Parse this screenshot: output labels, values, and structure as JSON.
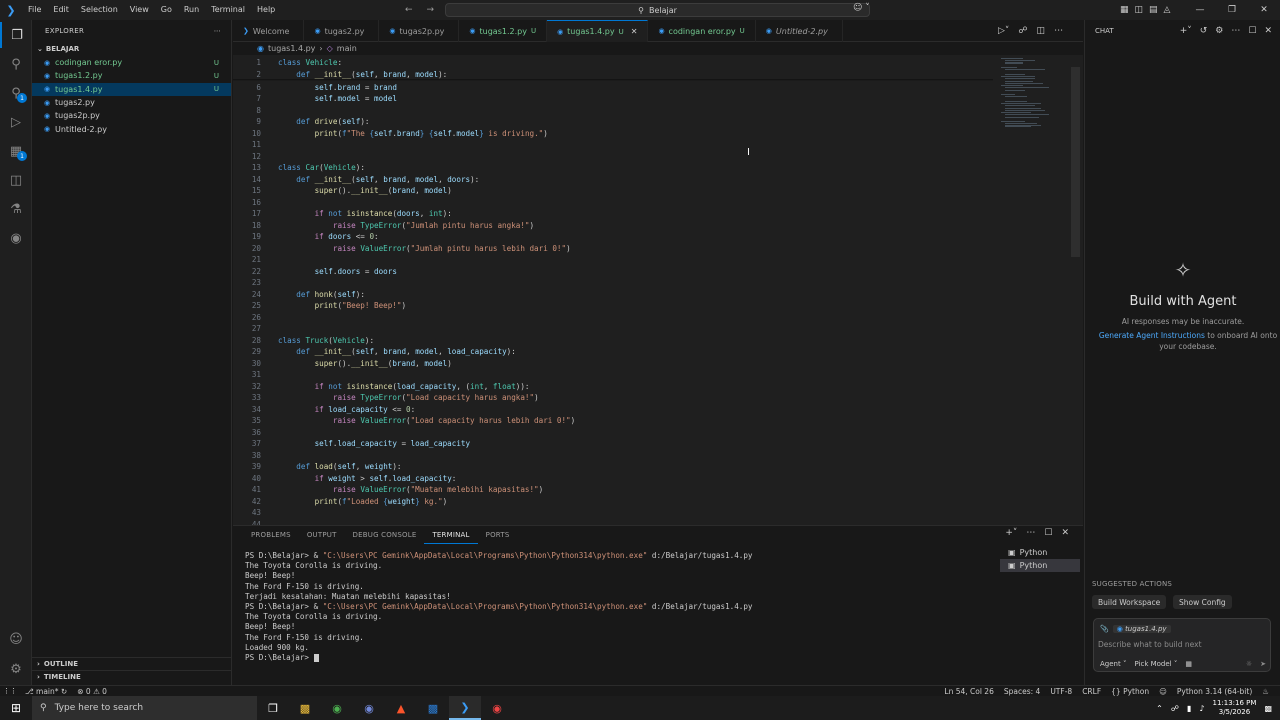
{
  "titlebar": {
    "menu": [
      "File",
      "Edit",
      "Selection",
      "View",
      "Go",
      "Run",
      "Terminal",
      "Help"
    ],
    "search": "Belajar"
  },
  "explorer": {
    "title": "EXPLORER",
    "folder": "BELAJAR",
    "files": [
      {
        "name": "codingan eror.py",
        "status": "U",
        "modified": true,
        "selected": false
      },
      {
        "name": "tugas1.2.py",
        "status": "U",
        "modified": true,
        "selected": false
      },
      {
        "name": "tugas1.4.py",
        "status": "U",
        "modified": true,
        "selected": true
      },
      {
        "name": "tugas2.py",
        "status": "",
        "modified": false,
        "selected": false
      },
      {
        "name": "tugas2p.py",
        "status": "",
        "modified": false,
        "selected": false
      },
      {
        "name": "Untitled-2.py",
        "status": "",
        "modified": false,
        "selected": false
      }
    ],
    "outline": "OUTLINE",
    "timeline": "TIMELINE"
  },
  "tabs": [
    {
      "label": "Welcome",
      "icon": "vscode-icon",
      "status": "",
      "modified": false,
      "italic": false,
      "active": false
    },
    {
      "label": "tugas2.py",
      "icon": "python-icon",
      "status": "",
      "modified": false,
      "italic": false,
      "active": false
    },
    {
      "label": "tugas2p.py",
      "icon": "python-icon",
      "status": "",
      "modified": false,
      "italic": false,
      "active": false
    },
    {
      "label": "tugas1.2.py",
      "icon": "python-icon",
      "status": "U",
      "modified": true,
      "italic": false,
      "active": false
    },
    {
      "label": "tugas1.4.py",
      "icon": "python-icon",
      "status": "U",
      "modified": true,
      "italic": false,
      "active": true
    },
    {
      "label": "codingan eror.py",
      "icon": "python-icon",
      "status": "U",
      "modified": true,
      "italic": false,
      "active": false
    },
    {
      "label": "Untitled-2.py",
      "icon": "python-icon",
      "status": "",
      "modified": false,
      "italic": true,
      "active": false
    }
  ],
  "breadcrumb": {
    "file": "tugas1.4.py",
    "symbol": "main"
  },
  "code": [
    {
      "n": "1",
      "t": [
        [
          "kw",
          "class "
        ],
        [
          "cls",
          "Vehicle"
        ],
        [
          "",
          ":"
        ]
      ]
    },
    {
      "n": "2",
      "t": [
        [
          "",
          "    "
        ],
        [
          "kw",
          "def "
        ],
        [
          "fn",
          "__init__"
        ],
        [
          "",
          "("
        ],
        [
          "var",
          "self"
        ],
        [
          "",
          ", "
        ],
        [
          "var",
          "brand"
        ],
        [
          "",
          ", "
        ],
        [
          "var",
          "model"
        ],
        [
          "",
          "):"
        ]
      ]
    },
    {
      "n": "6",
      "t": [
        [
          "",
          "        "
        ],
        [
          "var",
          "self"
        ],
        [
          "",
          "."
        ],
        [
          "var",
          "brand"
        ],
        [
          "",
          " = "
        ],
        [
          "var",
          "brand"
        ]
      ]
    },
    {
      "n": "7",
      "t": [
        [
          "",
          "        "
        ],
        [
          "var",
          "self"
        ],
        [
          "",
          "."
        ],
        [
          "var",
          "model"
        ],
        [
          "",
          " = "
        ],
        [
          "var",
          "model"
        ]
      ]
    },
    {
      "n": "8",
      "t": []
    },
    {
      "n": "9",
      "t": [
        [
          "",
          "    "
        ],
        [
          "kw",
          "def "
        ],
        [
          "fn",
          "drive"
        ],
        [
          "",
          "("
        ],
        [
          "var",
          "self"
        ],
        [
          "",
          "):"
        ]
      ]
    },
    {
      "n": "10",
      "t": [
        [
          "",
          "        "
        ],
        [
          "fn",
          "print"
        ],
        [
          "",
          "("
        ],
        [
          "fstr",
          "f"
        ],
        [
          "str",
          "\"The "
        ],
        [
          "fstr",
          "{"
        ],
        [
          "var",
          "self"
        ],
        [
          "",
          "."
        ],
        [
          "var",
          "brand"
        ],
        [
          "fstr",
          "}"
        ],
        [
          "str",
          " "
        ],
        [
          "fstr",
          "{"
        ],
        [
          "var",
          "self"
        ],
        [
          "",
          "."
        ],
        [
          "var",
          "model"
        ],
        [
          "fstr",
          "}"
        ],
        [
          "str",
          " is driving.\""
        ],
        [
          "",
          ")"
        ]
      ]
    },
    {
      "n": "11",
      "t": []
    },
    {
      "n": "12",
      "t": []
    },
    {
      "n": "13",
      "t": [
        [
          "kw",
          "class "
        ],
        [
          "cls",
          "Car"
        ],
        [
          "",
          "("
        ],
        [
          "cls",
          "Vehicle"
        ],
        [
          "",
          "):"
        ]
      ]
    },
    {
      "n": "14",
      "t": [
        [
          "",
          "    "
        ],
        [
          "kw",
          "def "
        ],
        [
          "fn",
          "__init__"
        ],
        [
          "",
          "("
        ],
        [
          "var",
          "self"
        ],
        [
          "",
          ", "
        ],
        [
          "var",
          "brand"
        ],
        [
          "",
          ", "
        ],
        [
          "var",
          "model"
        ],
        [
          "",
          ", "
        ],
        [
          "var",
          "doors"
        ],
        [
          "",
          "):"
        ]
      ]
    },
    {
      "n": "15",
      "t": [
        [
          "",
          "        "
        ],
        [
          "fn",
          "super"
        ],
        [
          "",
          "()."
        ],
        [
          "fn",
          "__init__"
        ],
        [
          "",
          "("
        ],
        [
          "var",
          "brand"
        ],
        [
          "",
          ", "
        ],
        [
          "var",
          "model"
        ],
        [
          "",
          ")"
        ]
      ]
    },
    {
      "n": "16",
      "t": []
    },
    {
      "n": "17",
      "t": [
        [
          "",
          "        "
        ],
        [
          "kw2",
          "if "
        ],
        [
          "kw",
          "not "
        ],
        [
          "fn",
          "isinstance"
        ],
        [
          "",
          "("
        ],
        [
          "var",
          "doors"
        ],
        [
          "",
          ", "
        ],
        [
          "cls",
          "int"
        ],
        [
          "",
          "):"
        ]
      ]
    },
    {
      "n": "18",
      "t": [
        [
          "",
          "            "
        ],
        [
          "kw2",
          "raise "
        ],
        [
          "cls",
          "TypeError"
        ],
        [
          "",
          "("
        ],
        [
          "str",
          "\"Jumlah pintu harus angka!\""
        ],
        [
          "",
          ")"
        ]
      ]
    },
    {
      "n": "19",
      "t": [
        [
          "",
          "        "
        ],
        [
          "kw2",
          "if "
        ],
        [
          "var",
          "doors"
        ],
        [
          "",
          " <= "
        ],
        [
          "num",
          "0"
        ],
        [
          "",
          ":"
        ]
      ]
    },
    {
      "n": "20",
      "t": [
        [
          "",
          "            "
        ],
        [
          "kw2",
          "raise "
        ],
        [
          "cls",
          "ValueError"
        ],
        [
          "",
          "("
        ],
        [
          "str",
          "\"Jumlah pintu harus lebih dari 0!\""
        ],
        [
          "",
          ")"
        ]
      ]
    },
    {
      "n": "21",
      "t": []
    },
    {
      "n": "22",
      "t": [
        [
          "",
          "        "
        ],
        [
          "var",
          "self"
        ],
        [
          "",
          "."
        ],
        [
          "var",
          "doors"
        ],
        [
          "",
          " = "
        ],
        [
          "var",
          "doors"
        ]
      ]
    },
    {
      "n": "23",
      "t": []
    },
    {
      "n": "24",
      "t": [
        [
          "",
          "    "
        ],
        [
          "kw",
          "def "
        ],
        [
          "fn",
          "honk"
        ],
        [
          "",
          "("
        ],
        [
          "var",
          "self"
        ],
        [
          "",
          "):"
        ]
      ]
    },
    {
      "n": "25",
      "t": [
        [
          "",
          "        "
        ],
        [
          "fn",
          "print"
        ],
        [
          "",
          "("
        ],
        [
          "str",
          "\"Beep! Beep!\""
        ],
        [
          "",
          ")"
        ]
      ]
    },
    {
      "n": "26",
      "t": []
    },
    {
      "n": "27",
      "t": []
    },
    {
      "n": "28",
      "t": [
        [
          "kw",
          "class "
        ],
        [
          "cls",
          "Truck"
        ],
        [
          "",
          "("
        ],
        [
          "cls",
          "Vehicle"
        ],
        [
          "",
          "):"
        ]
      ]
    },
    {
      "n": "29",
      "t": [
        [
          "",
          "    "
        ],
        [
          "kw",
          "def "
        ],
        [
          "fn",
          "__init__"
        ],
        [
          "",
          "("
        ],
        [
          "var",
          "self"
        ],
        [
          "",
          ", "
        ],
        [
          "var",
          "brand"
        ],
        [
          "",
          ", "
        ],
        [
          "var",
          "model"
        ],
        [
          "",
          ", "
        ],
        [
          "var",
          "load_capacity"
        ],
        [
          "",
          "):"
        ]
      ]
    },
    {
      "n": "30",
      "t": [
        [
          "",
          "        "
        ],
        [
          "fn",
          "super"
        ],
        [
          "",
          "()."
        ],
        [
          "fn",
          "__init__"
        ],
        [
          "",
          "("
        ],
        [
          "var",
          "brand"
        ],
        [
          "",
          ", "
        ],
        [
          "var",
          "model"
        ],
        [
          "",
          ")"
        ]
      ]
    },
    {
      "n": "31",
      "t": []
    },
    {
      "n": "32",
      "t": [
        [
          "",
          "        "
        ],
        [
          "kw2",
          "if "
        ],
        [
          "kw",
          "not "
        ],
        [
          "fn",
          "isinstance"
        ],
        [
          "",
          "("
        ],
        [
          "var",
          "load_capacity"
        ],
        [
          "",
          ", ("
        ],
        [
          "cls",
          "int"
        ],
        [
          "",
          ", "
        ],
        [
          "cls",
          "float"
        ],
        [
          "",
          ")):"
        ]
      ]
    },
    {
      "n": "33",
      "t": [
        [
          "",
          "            "
        ],
        [
          "kw2",
          "raise "
        ],
        [
          "cls",
          "TypeError"
        ],
        [
          "",
          "("
        ],
        [
          "str",
          "\"Load capacity harus angka!\""
        ],
        [
          "",
          ")"
        ]
      ]
    },
    {
      "n": "34",
      "t": [
        [
          "",
          "        "
        ],
        [
          "kw2",
          "if "
        ],
        [
          "var",
          "load_capacity"
        ],
        [
          "",
          " <= "
        ],
        [
          "num",
          "0"
        ],
        [
          "",
          ":"
        ]
      ]
    },
    {
      "n": "35",
      "t": [
        [
          "",
          "            "
        ],
        [
          "kw2",
          "raise "
        ],
        [
          "cls",
          "ValueError"
        ],
        [
          "",
          "("
        ],
        [
          "str",
          "\"Load capacity harus lebih dari 0!\""
        ],
        [
          "",
          ")"
        ]
      ]
    },
    {
      "n": "36",
      "t": []
    },
    {
      "n": "37",
      "t": [
        [
          "",
          "        "
        ],
        [
          "var",
          "self"
        ],
        [
          "",
          "."
        ],
        [
          "var",
          "load_capacity"
        ],
        [
          "",
          " = "
        ],
        [
          "var",
          "load_capacity"
        ]
      ]
    },
    {
      "n": "38",
      "t": []
    },
    {
      "n": "39",
      "t": [
        [
          "",
          "    "
        ],
        [
          "kw",
          "def "
        ],
        [
          "fn",
          "load"
        ],
        [
          "",
          "("
        ],
        [
          "var",
          "self"
        ],
        [
          "",
          ", "
        ],
        [
          "var",
          "weight"
        ],
        [
          "",
          "):"
        ]
      ]
    },
    {
      "n": "40",
      "t": [
        [
          "",
          "        "
        ],
        [
          "kw2",
          "if "
        ],
        [
          "var",
          "weight"
        ],
        [
          "",
          " > "
        ],
        [
          "var",
          "self"
        ],
        [
          "",
          "."
        ],
        [
          "var",
          "load_capacity"
        ],
        [
          "",
          ":"
        ]
      ]
    },
    {
      "n": "41",
      "t": [
        [
          "",
          "            "
        ],
        [
          "kw2",
          "raise "
        ],
        [
          "cls",
          "ValueError"
        ],
        [
          "",
          "("
        ],
        [
          "str",
          "\"Muatan melebihi kapasitas!\""
        ],
        [
          "",
          ")"
        ]
      ]
    },
    {
      "n": "42",
      "t": [
        [
          "",
          "        "
        ],
        [
          "fn",
          "print"
        ],
        [
          "",
          "("
        ],
        [
          "fstr",
          "f"
        ],
        [
          "str",
          "\"Loaded "
        ],
        [
          "fstr",
          "{"
        ],
        [
          "var",
          "weight"
        ],
        [
          "fstr",
          "}"
        ],
        [
          "str",
          " kg.\""
        ],
        [
          "",
          ")"
        ]
      ]
    },
    {
      "n": "43",
      "t": []
    },
    {
      "n": "44",
      "t": []
    }
  ],
  "panel": {
    "tabs": [
      "PROBLEMS",
      "OUTPUT",
      "DEBUG CONSOLE",
      "TERMINAL",
      "PORTS"
    ],
    "active_tab": "TERMINAL",
    "terminal_lines": [
      {
        "type": "cmd",
        "prompt": "PS D:\\Belajar> & ",
        "path": "\"C:\\Users\\PC Gemink\\AppData\\Local\\Programs\\Python\\Python314\\python.exe\"",
        "arg": " d:/Belajar/tugas1.4.py"
      },
      {
        "type": "out",
        "text": "The Toyota Corolla is driving."
      },
      {
        "type": "out",
        "text": "Beep! Beep!"
      },
      {
        "type": "out",
        "text": "The Ford F-150 is driving."
      },
      {
        "type": "out",
        "text": "Terjadi kesalahan: Muatan melebihi kapasitas!"
      },
      {
        "type": "cmd",
        "prompt": "PS D:\\Belajar> & ",
        "path": "\"C:\\Users\\PC Gemink\\AppData\\Local\\Programs\\Python\\Python314\\python.exe\"",
        "arg": " d:/Belajar/tugas1.4.py"
      },
      {
        "type": "out",
        "text": "The Toyota Corolla is driving."
      },
      {
        "type": "out",
        "text": "Beep! Beep!"
      },
      {
        "type": "out",
        "text": "The Ford F-150 is driving."
      },
      {
        "type": "out",
        "text": "Loaded 900 kg."
      },
      {
        "type": "prompt",
        "text": "PS D:\\Belajar> "
      }
    ],
    "terminals": [
      "Python",
      "Python"
    ]
  },
  "chat": {
    "title": "CHAT",
    "heading": "Build with Agent",
    "subtitle": "AI responses may be inaccurate.",
    "link": "Generate Agent Instructions",
    "link_rest": " to onboard AI onto your codebase.",
    "suggested_title": "SUGGESTED ACTIONS",
    "suggestions": [
      "Build Workspace",
      "Show Config"
    ],
    "context_file": "tugas1.4.py",
    "input_placeholder": "Describe what to build next",
    "mode": "Agent",
    "model": "Pick Model"
  },
  "statusbar": {
    "branch": "main*",
    "errors": "0",
    "warnings": "0",
    "position": "Ln 54, Col 26",
    "spaces": "Spaces: 4",
    "encoding": "UTF-8",
    "eol": "CRLF",
    "language": "Python",
    "interpreter": "Python 3.14 (64-bit)"
  },
  "taskbar": {
    "search_placeholder": "Type here to search",
    "time": "11:13:16 PM",
    "date": "3/5/2026"
  },
  "colors": {
    "accent": "#0078d4",
    "modified": "#73c991",
    "editor_bg": "#1f1f1f"
  }
}
